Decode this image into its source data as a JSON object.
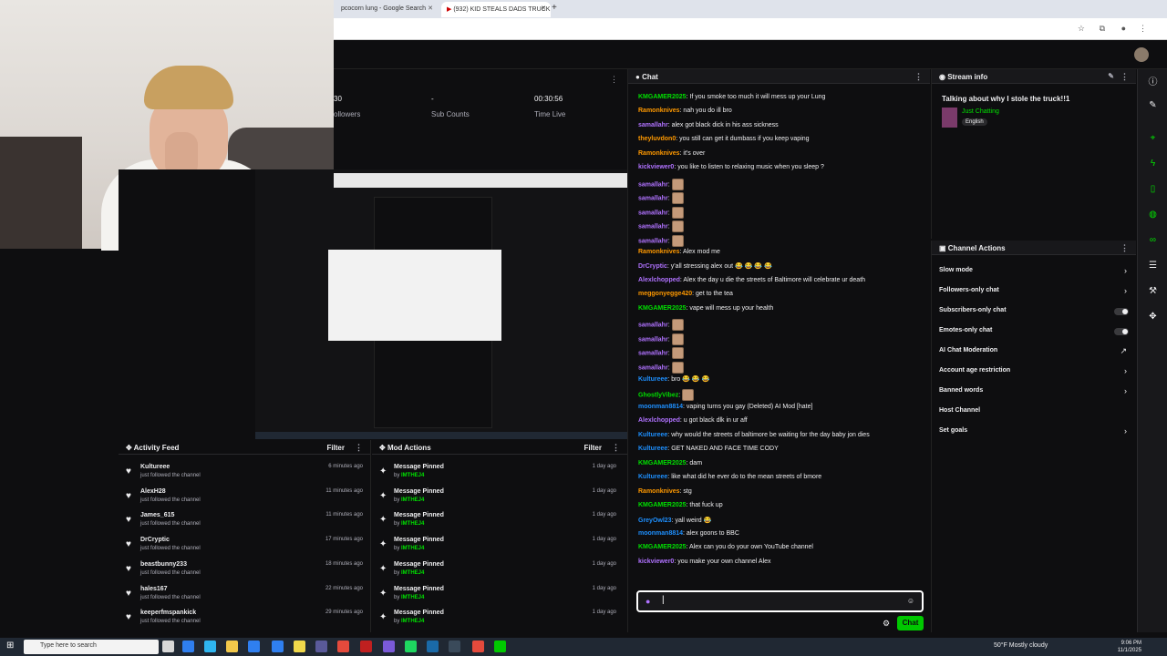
{
  "browser": {
    "tabs": [
      "pcocorn lung - Google Search",
      "(932) KID STEALS DADS TRUCK"
    ],
    "new_tab": "+"
  },
  "stats": {
    "followers_value": "30",
    "followers_label": "ollowers",
    "subs_value": "-",
    "subs_label": "Sub Counts",
    "time_value": "00:30:56",
    "time_label": "Time Live"
  },
  "chat": {
    "title": "Chat",
    "input_placeholder": "",
    "send_label": "Chat",
    "messages": [
      {
        "user": "KMGAMER2025",
        "color": "#00e000",
        "text": "If you smoke too much it will mess up your Lung"
      },
      {
        "user": "Ramonknives",
        "color": "#ff9900",
        "text": "nah you do ill bro"
      },
      {
        "user": "samallahr",
        "color": "#b072ff",
        "text": "alex got black dick in his ass sickness"
      },
      {
        "user": "theyluvdon0",
        "color": "#ff9900",
        "text": "you still can get it dumbass if you keep vaping"
      },
      {
        "user": "Ramonknives",
        "color": "#ff9900",
        "text": "it's over"
      },
      {
        "user": "kickviewer0",
        "color": "#b072ff",
        "text": "you like to listen to relaxing music when you sleep ?"
      },
      {
        "user": "samallahr",
        "color": "#b072ff",
        "text": "",
        "emote": true
      },
      {
        "user": "samallahr",
        "color": "#b072ff",
        "text": "",
        "emote": true
      },
      {
        "user": "samallahr",
        "color": "#b072ff",
        "text": "",
        "emote": true
      },
      {
        "user": "samallahr",
        "color": "#b072ff",
        "text": "",
        "emote": true
      },
      {
        "user": "samallahr",
        "color": "#b072ff",
        "text": "",
        "emote": true
      },
      {
        "user": "Ramonknives",
        "color": "#ff9900",
        "text": "Alex mod me"
      },
      {
        "user": "DrCryptic",
        "color": "#b072ff",
        "text": "y'all stressing alex out 😂 😂 😂 😂"
      },
      {
        "user": "Alexlchopped",
        "color": "#b072ff",
        "text": "Alex the day u die the streets of Baltimore will celebrate ur death"
      },
      {
        "user": "meggonyegge420",
        "color": "#ff9900",
        "text": "get to the tea"
      },
      {
        "user": "KMGAMER2025",
        "color": "#00e000",
        "text": "vape will mess up your health"
      },
      {
        "user": "samallahr",
        "color": "#b072ff",
        "text": "",
        "emote": true
      },
      {
        "user": "samallahr",
        "color": "#b072ff",
        "text": "",
        "emote": true
      },
      {
        "user": "samallahr",
        "color": "#b072ff",
        "text": "",
        "emote": true
      },
      {
        "user": "samallahr",
        "color": "#b072ff",
        "text": "",
        "emote": true
      },
      {
        "user": "Kultureee",
        "color": "#1e90ff",
        "text": "bro 😂 😂 😂"
      },
      {
        "user": "GhostlyVibez",
        "color": "#00e000",
        "text": "",
        "emote": true
      },
      {
        "user": "moonman8814",
        "color": "#1e90ff",
        "text": "vaping turns you gay (Deleted) AI Mod [hate]"
      },
      {
        "user": "Alexlchopped",
        "color": "#b072ff",
        "text": "u got black dlk in ur aff"
      },
      {
        "user": "Kultureee",
        "color": "#1e90ff",
        "text": "why would the streets of baltimore be waiting for the day baby jon dies"
      },
      {
        "user": "Kultureee",
        "color": "#1e90ff",
        "text": "GET NAKED AND FACE TIME CODY"
      },
      {
        "user": "KMGAMER2025",
        "color": "#00e000",
        "text": "dam"
      },
      {
        "user": "Kultureee",
        "color": "#1e90ff",
        "text": "like what did he ever do to the mean streets of bmore"
      },
      {
        "user": "Ramonknives",
        "color": "#ff9900",
        "text": "stg"
      },
      {
        "user": "KMGAMER2025",
        "color": "#00e000",
        "text": "that fuck up"
      },
      {
        "user": "GreyOwl23",
        "color": "#1e90ff",
        "text": "yall weird 😂"
      },
      {
        "user": "moonman8814",
        "color": "#1e90ff",
        "text": "alex goons to BBC"
      },
      {
        "user": "KMGAMER2025",
        "color": "#00e000",
        "text": "Alex can you do your own YouTube channel"
      },
      {
        "user": "kickviewer0",
        "color": "#b072ff",
        "text": "you make your own channel Alex"
      }
    ]
  },
  "stream_info": {
    "title": "Stream info",
    "stream_title": "Talking about why I stole the truck!!1",
    "category": "Just Chatting",
    "language": "English"
  },
  "channel_actions": {
    "title": "Channel Actions",
    "items": [
      {
        "label": "Slow mode",
        "kind": "chevron"
      },
      {
        "label": "Followers-only chat",
        "kind": "chevron"
      },
      {
        "label": "Subscribers-only chat",
        "kind": "toggle"
      },
      {
        "label": "Emotes-only chat",
        "kind": "toggle"
      },
      {
        "label": "AI Chat Moderation",
        "kind": "icon"
      },
      {
        "label": "Account age restriction",
        "kind": "chevron"
      },
      {
        "label": "Banned words",
        "kind": "chevron"
      },
      {
        "label": "Host Channel",
        "kind": "none"
      },
      {
        "label": "Set goals",
        "kind": "chevron"
      }
    ]
  },
  "activity_feed": {
    "title": "Activity Feed",
    "filter": "Filter",
    "items": [
      {
        "name": "Kultureee",
        "sub": "just followed the channel",
        "time": "6 minutes ago"
      },
      {
        "name": "AlexH28",
        "sub": "just followed the channel",
        "time": "11 minutes ago"
      },
      {
        "name": "James_615",
        "sub": "just followed the channel",
        "time": "11 minutes ago"
      },
      {
        "name": "DrCryptic",
        "sub": "just followed the channel",
        "time": "17 minutes ago"
      },
      {
        "name": "beastbunny233",
        "sub": "just followed the channel",
        "time": "18 minutes ago"
      },
      {
        "name": "hales167",
        "sub": "just followed the channel",
        "time": "22 minutes ago"
      },
      {
        "name": "keeperfmspankick",
        "sub": "just followed the channel",
        "time": "29 minutes ago"
      }
    ]
  },
  "mod_actions": {
    "title": "Mod Actions",
    "filter": "Filter",
    "items": [
      {
        "name": "Message Pinned",
        "by": "IMTHEJ4",
        "time": "1 day ago"
      },
      {
        "name": "Message Pinned",
        "by": "IMTHEJ4",
        "time": "1 day ago"
      },
      {
        "name": "Message Pinned",
        "by": "IMTHEJ4",
        "time": "1 day ago"
      },
      {
        "name": "Message Pinned",
        "by": "IMTHEJ4",
        "time": "1 day ago"
      },
      {
        "name": "Message Pinned",
        "by": "IMTHEJ4",
        "time": "1 day ago"
      },
      {
        "name": "Message Pinned",
        "by": "IMTHEJ4",
        "time": "1 day ago"
      },
      {
        "name": "Message Pinned",
        "by": "IMTHEJ4",
        "time": "1 day ago"
      }
    ]
  },
  "taskbar": {
    "search_placeholder": "Type here to search",
    "weather": "50°F Mostly cloudy",
    "time": "9:06 PM",
    "date": "11/1/2025"
  },
  "colors": {
    "accent": "#00e000",
    "background": "#0e0e10",
    "panel": "#18181b"
  }
}
